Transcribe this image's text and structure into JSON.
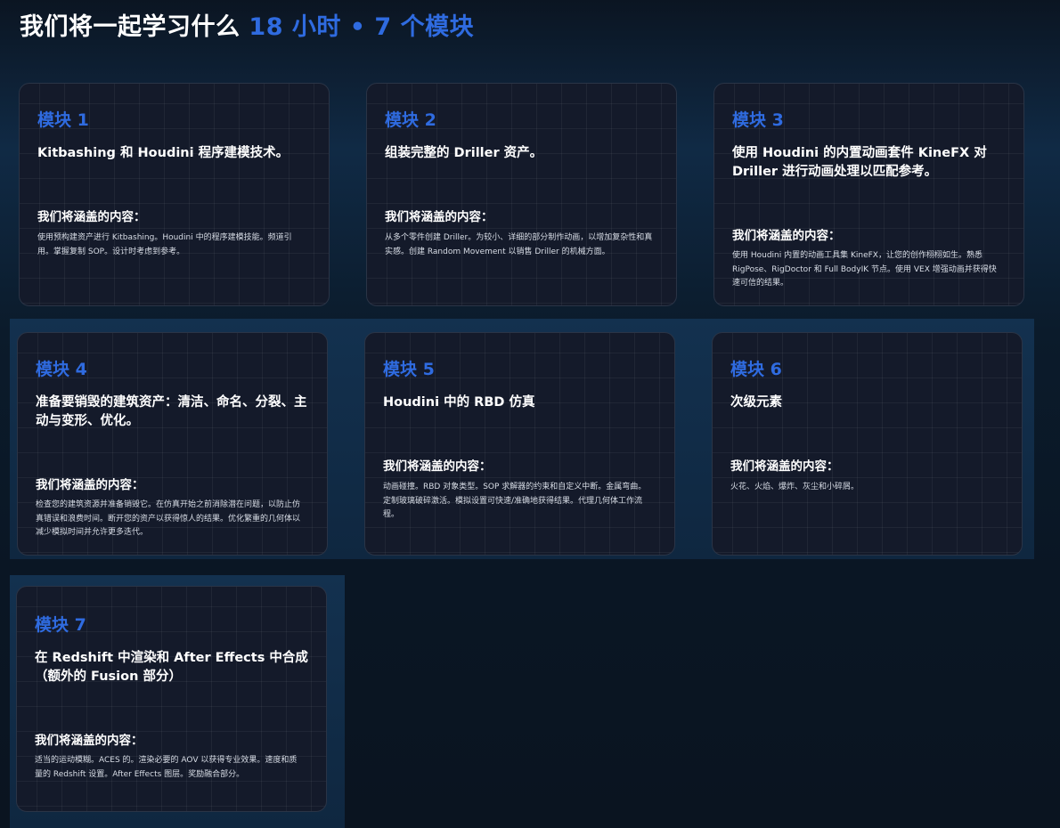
{
  "header": {
    "title_main": "我们将一起学习什么 ",
    "title_accent": "18 小时 • 7 个模块"
  },
  "colors": {
    "accent": "#2f6be0",
    "background": "#0a1420",
    "card_background": "#141a2a",
    "card_border": "#2a3446"
  },
  "modules": [
    {
      "label": "模块 1",
      "title": "Kitbashing 和 Houdini 程序建模技术。",
      "subtitle": "我们将涵盖的内容：",
      "description": "使用预构建资产进行 Kitbashing。Houdini 中的程序建模技能。频道引用。掌握复制 SOP。设计时考虑到参考。"
    },
    {
      "label": "模块 2",
      "title": "组装完整的 Driller 资产。",
      "subtitle": "我们将涵盖的内容：",
      "description": "从多个零件创建 Driller。为较小、详细的部分制作动画，以增加复杂性和真实感。创建 Random Movement 以销售 Driller 的机械方面。"
    },
    {
      "label": "模块 3",
      "title": "使用 Houdini 的内置动画套件 KineFX 对 Driller 进行动画处理以匹配参考。",
      "subtitle": "我们将涵盖的内容：",
      "description": "使用 Houdini 内置的动画工具集 KineFX，让您的创作栩栩如生。熟悉 RigPose、RigDoctor 和 Full BodyIK 节点。使用 VEX 增强动画并获得快速可信的结果。"
    },
    {
      "label": "模块 4",
      "title": "准备要销毁的建筑资产：清洁、命名、分裂、主动与变形、优化。",
      "subtitle": "我们将涵盖的内容：",
      "description": "检查您的建筑资源并准备销毁它。在仿真开始之前消除潜在问题，以防止仿真错误和浪费时间。断开您的资产以获得惊人的结果。优化繁重的几何体以减少模拟时间并允许更多迭代。"
    },
    {
      "label": "模块 5",
      "title": "Houdini 中的 RBD 仿真",
      "subtitle": "我们将涵盖的内容：",
      "description": "动画碰撞。RBD 对象类型。SOP 求解器的约束和自定义中断。金属弯曲。定制玻璃破碎激活。模拟设置可快速/准确地获得结果。代理几何体工作流程。"
    },
    {
      "label": "模块 6",
      "title": "次级元素",
      "subtitle": "我们将涵盖的内容：",
      "description": "火花、火焰、爆炸、灰尘和小碎屑。"
    },
    {
      "label": "模块 7",
      "title": "在 Redshift 中渲染和 After Effects 中合成（额外的 Fusion 部分）",
      "subtitle": "我们将涵盖的内容：",
      "description": "适当的运动模糊。ACES 的。渲染必要的 AOV 以获得专业效果。速度和质量的 Redshift 设置。After Effects 图层。奖励融合部分。"
    }
  ]
}
